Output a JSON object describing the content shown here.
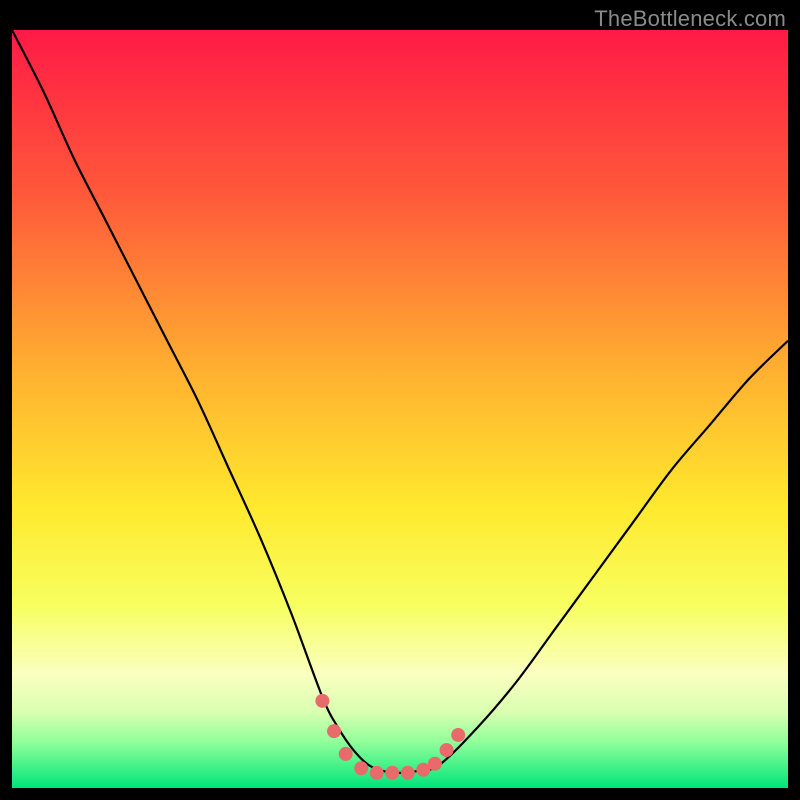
{
  "watermark": {
    "text": "TheBottleneck.com"
  },
  "chart_data": {
    "type": "line",
    "title": "",
    "xlabel": "",
    "ylabel": "",
    "xlim": [
      0,
      100
    ],
    "ylim": [
      0,
      100
    ],
    "background_gradient": {
      "stops": [
        {
          "offset": 0,
          "color": "#ff1a46"
        },
        {
          "offset": 22,
          "color": "#ff5a3a"
        },
        {
          "offset": 45,
          "color": "#ffb030"
        },
        {
          "offset": 63,
          "color": "#ffe92e"
        },
        {
          "offset": 76,
          "color": "#f7ff60"
        },
        {
          "offset": 85,
          "color": "#faffc0"
        },
        {
          "offset": 90,
          "color": "#d9ffb0"
        },
        {
          "offset": 94,
          "color": "#8fff9a"
        },
        {
          "offset": 100,
          "color": "#00e47a"
        }
      ]
    },
    "series": [
      {
        "name": "bottleneck-curve",
        "color": "#000000",
        "stroke_width": 2.2,
        "x": [
          0,
          4,
          8,
          12,
          16,
          20,
          24,
          28,
          32,
          36,
          40,
          42,
          44,
          46,
          48,
          50,
          52,
          55,
          60,
          65,
          70,
          75,
          80,
          85,
          90,
          95,
          100
        ],
        "y": [
          100,
          92,
          83,
          75,
          67,
          59,
          51,
          42,
          33,
          23,
          12,
          8,
          5,
          3,
          2.2,
          2,
          2.2,
          3,
          8,
          14,
          21,
          28,
          35,
          42,
          48,
          54,
          59
        ]
      }
    ],
    "markers": {
      "name": "flat-bottom-dots",
      "color": "#e86a6a",
      "radius": 7,
      "points": [
        {
          "x": 40.0,
          "y": 11.5
        },
        {
          "x": 41.5,
          "y": 7.5
        },
        {
          "x": 43.0,
          "y": 4.5
        },
        {
          "x": 45.0,
          "y": 2.6
        },
        {
          "x": 47.0,
          "y": 2.0
        },
        {
          "x": 49.0,
          "y": 2.0
        },
        {
          "x": 51.0,
          "y": 2.0
        },
        {
          "x": 53.0,
          "y": 2.4
        },
        {
          "x": 54.5,
          "y": 3.2
        },
        {
          "x": 56.0,
          "y": 5.0
        },
        {
          "x": 57.5,
          "y": 7.0
        }
      ]
    }
  }
}
